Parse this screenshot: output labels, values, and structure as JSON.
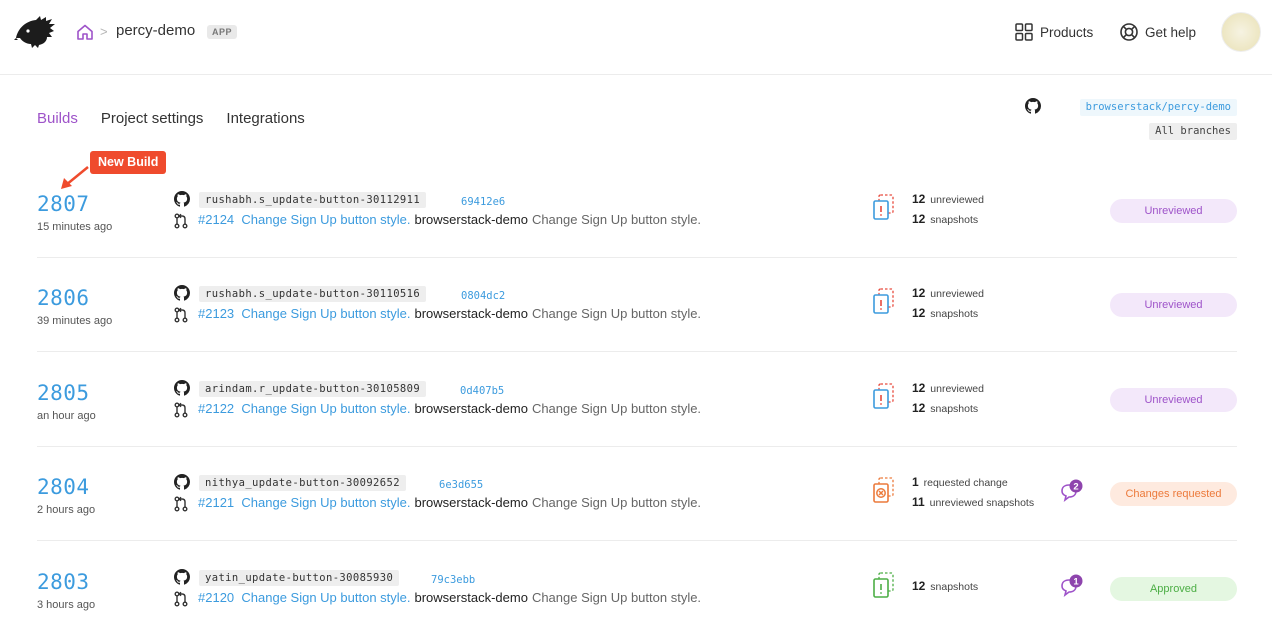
{
  "header": {
    "project_name": "percy-demo",
    "project_badge": "APP",
    "breadcrumb_sep": ">",
    "products_label": "Products",
    "help_label": "Get help"
  },
  "tabs": [
    {
      "label": "Builds",
      "active": true
    },
    {
      "label": "Project settings",
      "active": false
    },
    {
      "label": "Integrations",
      "active": false
    }
  ],
  "repo": {
    "name": "browserstack/percy-demo",
    "branch_filter": "All branches"
  },
  "callout": {
    "label": "New Build"
  },
  "colors": {
    "accent_purple": "#9e53c9",
    "link_blue": "#3c9bde",
    "callout_red": "#ef4b2d",
    "changes_orange": "#ec7a3b",
    "approved_green": "#4cae45"
  },
  "builds": [
    {
      "number": "2807",
      "time": "15 minutes ago",
      "branch": "rushabh.s_update-button-30112911",
      "sha": "69412e6",
      "pr": "#2124",
      "pr_title": "Change Sign Up button style.",
      "org": "browserstack-demo",
      "message": "Change Sign Up button style.",
      "stat1_num": "12",
      "stat1_label": "unreviewed",
      "stat2_num": "12",
      "stat2_label": "snapshots",
      "comments": "",
      "status": "Unreviewed",
      "status_type": "unreviewed",
      "icon": "unreviewed-snapshots-icon"
    },
    {
      "number": "2806",
      "time": "39 minutes ago",
      "branch": "rushabh.s_update-button-30110516",
      "sha": "0804dc2",
      "pr": "#2123",
      "pr_title": "Change Sign Up button style.",
      "org": "browserstack-demo",
      "message": "Change Sign Up button style.",
      "stat1_num": "12",
      "stat1_label": "unreviewed",
      "stat2_num": "12",
      "stat2_label": "snapshots",
      "comments": "",
      "status": "Unreviewed",
      "status_type": "unreviewed",
      "icon": "unreviewed-snapshots-icon"
    },
    {
      "number": "2805",
      "time": "an hour ago",
      "branch": "arindam.r_update-button-30105809",
      "sha": "0d407b5",
      "pr": "#2122",
      "pr_title": "Change Sign Up button style.",
      "org": "browserstack-demo",
      "message": "Change Sign Up button style.",
      "stat1_num": "12",
      "stat1_label": "unreviewed",
      "stat2_num": "12",
      "stat2_label": "snapshots",
      "comments": "",
      "status": "Unreviewed",
      "status_type": "unreviewed",
      "icon": "unreviewed-snapshots-icon"
    },
    {
      "number": "2804",
      "time": "2 hours ago",
      "branch": "nithya_update-button-30092652",
      "sha": "6e3d655",
      "pr": "#2121",
      "pr_title": "Change Sign Up button style.",
      "org": "browserstack-demo",
      "message": "Change Sign Up button style.",
      "stat1_num": "1",
      "stat1_label": "requested change",
      "stat2_num": "11",
      "stat2_label": "unreviewed snapshots",
      "comments": "2",
      "status": "Changes requested",
      "status_type": "changes",
      "icon": "changes-requested-snapshots-icon"
    },
    {
      "number": "2803",
      "time": "3 hours ago",
      "branch": "yatin_update-button-30085930",
      "sha": "79c3ebb",
      "pr": "#2120",
      "pr_title": "Change Sign Up button style.",
      "org": "browserstack-demo",
      "message": "Change Sign Up button style.",
      "stat1_num": "",
      "stat1_label": "",
      "stat2_num": "12",
      "stat2_label": "snapshots",
      "comments": "1",
      "status": "Approved",
      "status_type": "approved",
      "icon": "approved-snapshots-icon"
    }
  ]
}
